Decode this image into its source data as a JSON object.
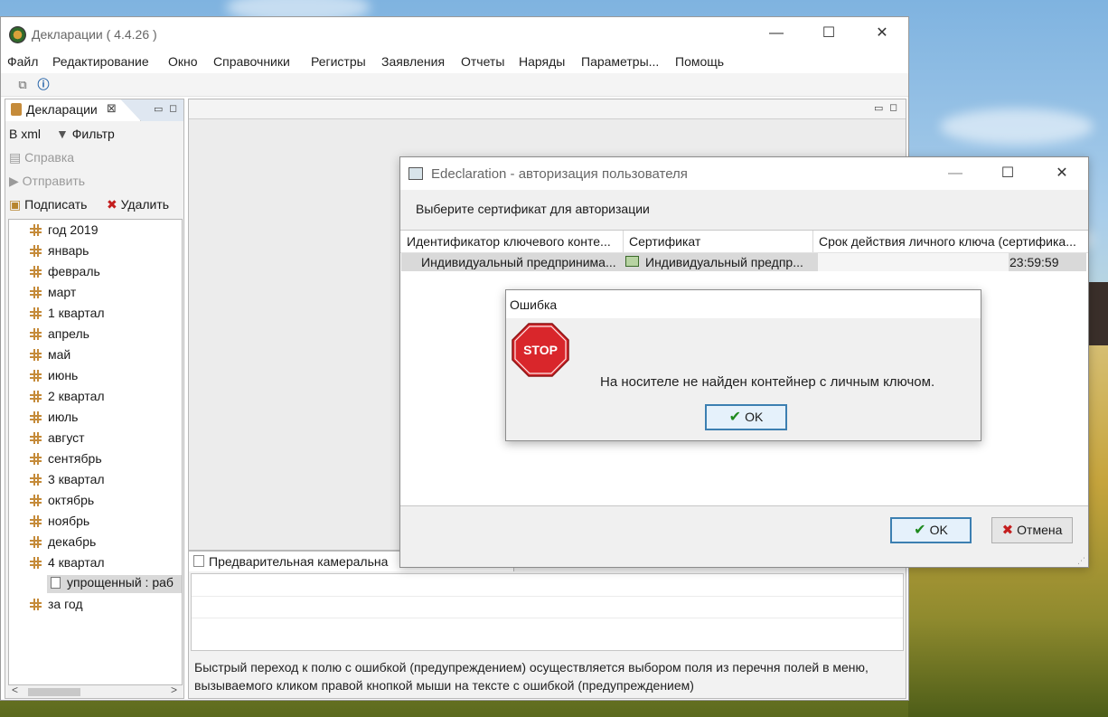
{
  "window": {
    "title": "Декларации ( 4.4.26 )",
    "controls": [
      "—",
      "☐",
      "✕"
    ]
  },
  "menu": [
    "Файл",
    "Редактирование",
    "Окно",
    "Справочники",
    "Регистры",
    "Заявления",
    "Отчеты",
    "Наряды",
    "Параметры...",
    "Помощь"
  ],
  "left_panel": {
    "tab_label": "Декларации",
    "close_glyph": "⊠",
    "actions": {
      "to_xml": "В xml",
      "filter": "Фильтр",
      "help": "Справка",
      "send": "Отправить",
      "sign": "Подписать",
      "delete": "Удалить"
    },
    "tree": {
      "root": "год 2019",
      "items": [
        "январь",
        "февраль",
        "март",
        "1 квартал",
        "апрель",
        "май",
        "июнь",
        "2 квартал",
        "июль",
        "август",
        "сентябрь",
        "3 квартал",
        "октябрь",
        "ноябрь",
        "декабрь",
        "4 квартал"
      ],
      "selected_child": "упрощенный : раб",
      "last": "за год"
    },
    "scroll_left": "<",
    "scroll_right": ">"
  },
  "bottom_panel": {
    "tab_label": "Предварительная камеральна",
    "hint": "Быстрый переход к полю с ошибкой (предупреждением) осуществляется выбором поля из перечня полей в меню, вызываемого кликом правой кнопкой мыши на тексте с ошибкой (предупреждением)"
  },
  "auth_dialog": {
    "title": "Edeclaration - авторизация пользователя",
    "prompt": "Выберите сертификат для авторизации",
    "columns": [
      "Идентификатор ключевого конте...",
      "Сертификат",
      "Срок действия личного ключа (сертифика..."
    ],
    "row": {
      "container": "Индивидуальный предпринима...",
      "certificate": "Индивидуальный предпр...",
      "expiry": "23:59:59"
    },
    "ok_label": "OK",
    "cancel_label": "Отмена"
  },
  "error_dialog": {
    "title": "Ошибка",
    "stop_text": "STOP",
    "message": "На носителе не найден контейнер с личным ключом.",
    "ok_label": "OK"
  },
  "colors": {
    "focus_border": "#3c7fb1",
    "stop_red": "#d9262b",
    "check_green": "#1e8a1e",
    "cross_red": "#c41e1e"
  }
}
